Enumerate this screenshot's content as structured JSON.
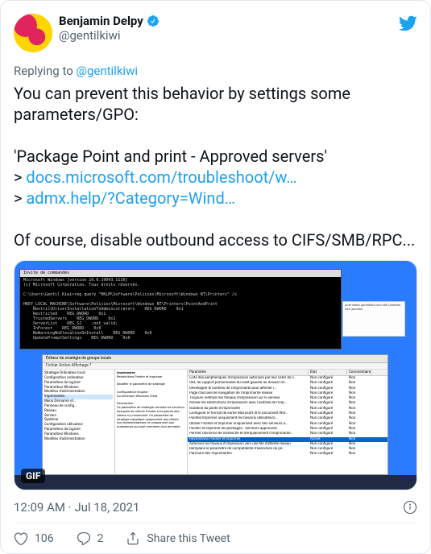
{
  "user": {
    "display_name": "Benjamin Delpy",
    "handle": "@gentilkiwi"
  },
  "reply": {
    "prefix": "Replying to ",
    "target": "@gentilkiwi"
  },
  "body": {
    "line1": "You can prevent this behavior by settings some parameters/GPO:",
    "line2": "'Package Point and print - Approved servers'",
    "link1_prefix": "> ",
    "link1": "docs.microsoft.com/troubleshoot/w…",
    "link2_prefix": "> ",
    "link2": "admx.help/?Category=Wind…",
    "line3": "Of course, disable outbound access to CIFS/SMB/RPC..."
  },
  "media": {
    "gif_label": "GIF",
    "cmd_title": "Invite de commandes",
    "cmd_lines": "Microsoft Windows [version 10.0.19043.1110]\n(c) Microsoft Corporation. Tous droits réservés.\n\nC:\\Users\\Gentil Kiwi>reg query \"HKLM\\Software\\Policies\\Microsoft\\Windows NT\\Printers\" /s\n\nHKEY_LOCAL_MACHINE\\Software\\Policies\\Microsoft\\Windows NT\\Printers\\PointAndPrint\n    RestrictDriverInstallationToAdministrators    REG_DWORD    0x1\n    Restricted    REG_DWORD    0x1\n    TrustedServers    REG_DWORD    0x1\n    ServerList    REG_SZ    ;not_valid;\n    InForest    REG_DWORD    0x0\n    NoWarningNoElevationOnInstall    REG_DWORD    0x0\n    UpdatePromptSettings    REG_DWORD    0x0",
    "gp_title": "Éditeur de stratégie de groupe locale",
    "gp_menu": "Fichier   Action   Affichage   ?",
    "gp_tree": [
      "Stratégie Ordinateur local",
      " Configuration ordinateur",
      "  Paramètres du logiciel",
      "  Paramètres Windows",
      "  Modèles d'administration",
      "   Imprimantes",
      "   Menu Démarrer et…",
      "   Panneau de config…",
      "   Réseau",
      "   Serveur",
      "   Système",
      " Configuration utilisateur",
      "  Paramètres du logiciel",
      "  Paramètres Windows",
      "  Modèles d'administration"
    ],
    "gp_desc_title": "Imprimantes",
    "gp_desc_body": "Restrictions Pointer et Imprimer\n\nModifier le paramètre de stratégie\n\nConfiguration requise :\nAu minimum Windows Vista\n\nDescription :\nCe paramètre de stratégie contrôle les serveurs auxquels les clients Pointer et Imprimer des clients s'y connectent. Ce paramètre de stratégie s'applique uniquement aux clients non-Administrateurs, et uniquement aux ordinateurs qui sont membres d'un domaine.",
    "gp_list_header": {
      "c1": "Paramètre",
      "c2": "État",
      "c3": "Commentaire"
    },
    "gp_rows": [
      {
        "c1": "Liste des périphériques d'impression autorisés par leur GUID de c…",
        "c2": "Non configuré",
        "c3": "Non"
      },
      {
        "c1": "URL de support personnalisé du volet gauche du dossier Im…",
        "c2": "Non configuré",
        "c3": "Non"
      },
      {
        "c1": "Développer le contenu de l'imprimante pour afficher i…",
        "c2": "Non configuré",
        "c3": "Non"
      },
      {
        "c1": "Page d'accueil de navigation de l'imprimante réseau",
        "c2": "Non configuré",
        "c3": "Non"
      },
      {
        "c1": "Toujours restituer les travaux d'impression sur le serveur",
        "c2": "Non configuré",
        "c3": "Non"
      },
      {
        "c1": "Activer les Restrictions d'impression avec Contrôle de l'imp…",
        "c2": "Non configuré",
        "c3": "Non"
      },
      {
        "c1": "Isolation du pilote d'imprimante",
        "c2": "Non configuré",
        "c3": "Non"
      },
      {
        "c1": "Configurer le format de sortie Microsoft XPS Document Writ…",
        "c2": "Non configuré",
        "c3": "Non"
      },
      {
        "c1": "Pointer/Imprimer uniquement les besoins utilisateurs…",
        "c2": "Non configuré",
        "c3": "Non"
      },
      {
        "c1": "Utiliser Pointer et Imprimer uniquement avec des serveurs a…",
        "c2": "Non configuré",
        "c3": "Non"
      },
      {
        "c1": "Pointer et imprimer les packages - Serveurs approuvés",
        "c2": "Non configuré",
        "c3": "Non"
      },
      {
        "c1": "Permet l'annonce de recherche et d'emplacement d'imprimante…",
        "c2": "Non configuré",
        "c3": "Non"
      },
      {
        "c1": "Restrictions Pointer et Imprimer",
        "c2": "Activé",
        "c3": "Non",
        "sel": true
      },
      {
        "c1": "Autoriser les travaux d'impression vers une file d'attente réseau",
        "c2": "Non configuré",
        "c3": "Non"
      },
      {
        "c1": "Remplace le paramètre de compatibilité d'exécution du pil…",
        "c2": "Non configuré",
        "c3": "Non"
      },
      {
        "c1": "Parcours des imprimantes",
        "c2": "Non configuré",
        "c3": "Non"
      }
    ],
    "popup": "prdc-share.gentilkiwi.com\n\nx86 (another\n\nx64 (another"
  },
  "timestamp": "12:09 AM · Jul 18, 2021",
  "actions": {
    "likes": "106",
    "replies": "2",
    "share": "Share this Tweet"
  }
}
